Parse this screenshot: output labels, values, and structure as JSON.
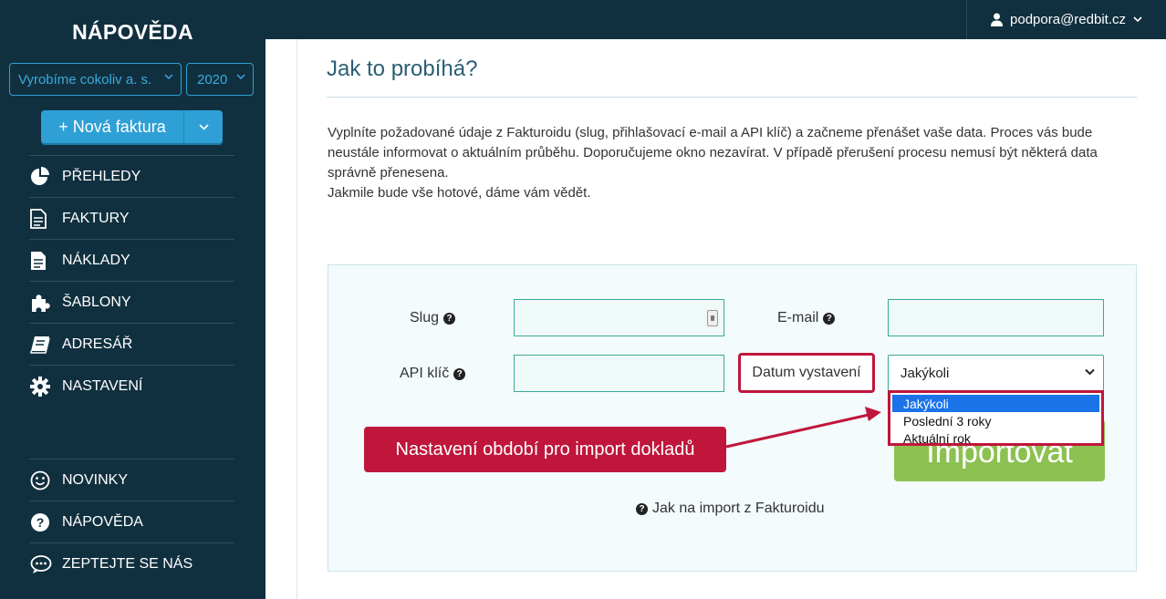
{
  "app": {
    "brand": "NÁPOVĚDA"
  },
  "user": {
    "email": "podpora@redbit.cz",
    "icon": "user-icon"
  },
  "company_select": {
    "value": "Vyrobíme cokoliv a. s."
  },
  "year_select": {
    "value": "2020"
  },
  "new_invoice": {
    "label": "+ Nová faktura"
  },
  "nav_main": [
    {
      "label": "PŘEHLEDY",
      "icon": "pie-chart-icon"
    },
    {
      "label": "FAKTURY",
      "icon": "invoice-icon"
    },
    {
      "label": "NÁKLADY",
      "icon": "document-icon"
    },
    {
      "label": "ŠABLONY",
      "icon": "puzzle-icon"
    },
    {
      "label": "ADRESÁŘ",
      "icon": "book-icon"
    },
    {
      "label": "NASTAVENÍ",
      "icon": "gear-icon"
    }
  ],
  "nav_bottom": [
    {
      "label": "NOVINKY",
      "icon": "smiley-icon"
    },
    {
      "label": "NÁPOVĚDA",
      "icon": "question-circle-icon"
    },
    {
      "label": "ZEPTEJTE SE NÁS",
      "icon": "chat-icon"
    }
  ],
  "page": {
    "title": "Jak to probíhá?",
    "intro_line1": "Vyplníte požadované údaje z Fakturoidu (slug, přihlašovací e-mail a API klíč) a začneme přenášet vaše data. Proces vás bude neustále informovat o aktuálním průběhu. Doporučujeme okno nezavírat. V případě přerušení procesu nemusí být některá data správně přenesena.",
    "intro_line2": "Jakmile bude vše hotové, dáme vám vědět."
  },
  "form": {
    "slug_label": "Slug",
    "email_label": "E-mail",
    "api_label": "API klíč",
    "date_label": "Datum vystavení",
    "date_value": "Jakýkoli",
    "date_options": [
      "Jakýkoli",
      "Poslední 3 roky",
      "Aktuální rok"
    ],
    "import_label": "Importovat",
    "help_link": "Jak na import z Fakturoidu"
  },
  "annotation": {
    "text": "Nastavení období pro import dokladů"
  },
  "colors": {
    "sidebar": "#11303f",
    "accent": "#2ea0d6",
    "highlight": "#c0163b",
    "import": "#8cc152",
    "title": "#2b5e75"
  }
}
